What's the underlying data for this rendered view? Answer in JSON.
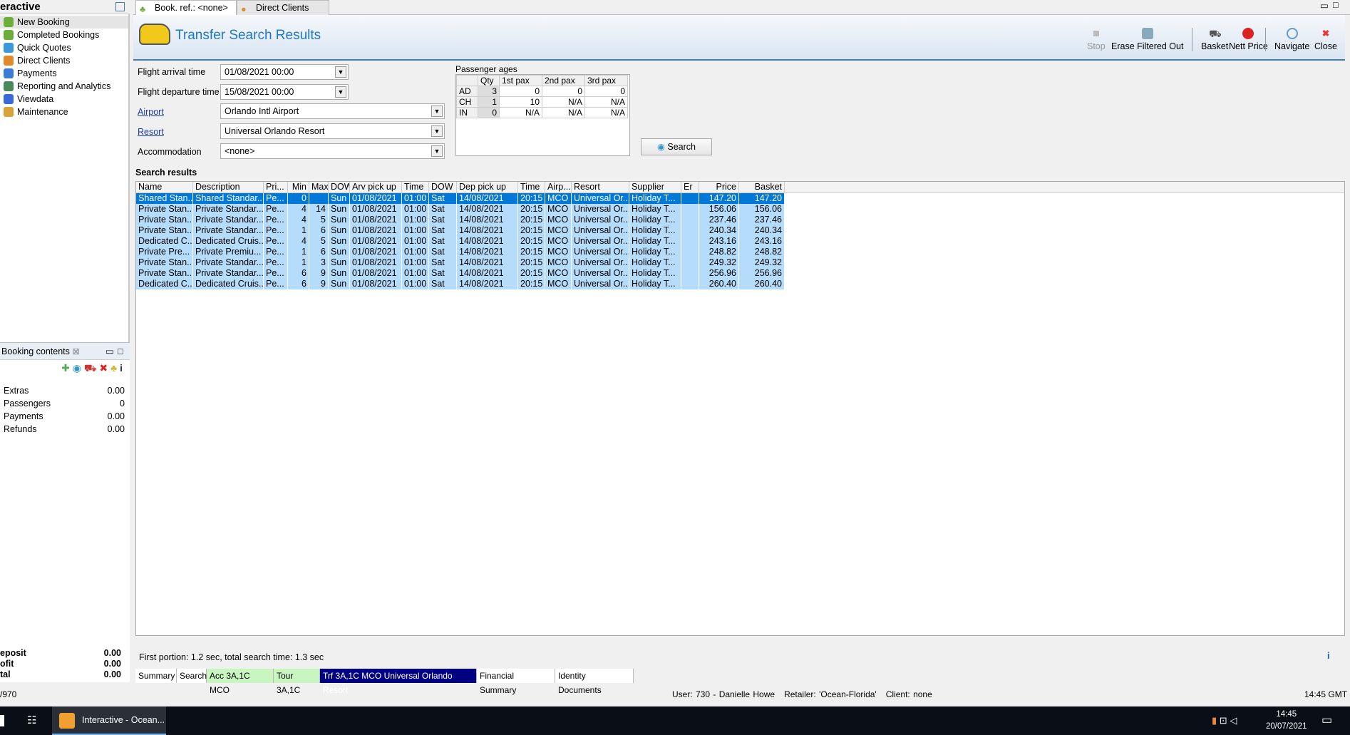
{
  "left_panel": {
    "title": "eractive",
    "nav": [
      {
        "label": "New Booking",
        "color": "#6cae3a"
      },
      {
        "label": "Completed Bookings",
        "color": "#6cae3a"
      },
      {
        "label": "Quick Quotes",
        "color": "#3a9ad9"
      },
      {
        "label": "Direct Clients",
        "color": "#e08a2a"
      },
      {
        "label": "Payments",
        "color": "#3a7ad9"
      },
      {
        "label": "Reporting and Analytics",
        "color": "#4a8a5a"
      },
      {
        "label": "Viewdata",
        "color": "#3a6ad9"
      },
      {
        "label": "Maintenance",
        "color": "#d9a23a"
      }
    ]
  },
  "booking_contents": {
    "title": "Booking contents",
    "rows": [
      {
        "label": "Extras",
        "value": "0.00"
      },
      {
        "label": "Passengers",
        "value": "0"
      },
      {
        "label": "Payments",
        "value": "0.00"
      },
      {
        "label": "Refunds",
        "value": "0.00"
      }
    ],
    "totals": [
      {
        "label": "eposit",
        "value": "0.00"
      },
      {
        "label": "ofit",
        "value": "0.00"
      },
      {
        "label": "tal",
        "value": "0.00"
      }
    ]
  },
  "tabs": [
    {
      "label": "Book. ref.: <none>"
    },
    {
      "label": "Direct Clients Search"
    }
  ],
  "header": {
    "title": "Transfer Search Results",
    "toolbar": [
      "Stop",
      "Erase Filtered Out",
      "Basket",
      "Nett Price",
      "Navigate",
      "Close"
    ]
  },
  "form": {
    "arrival_label": "Flight arrival time",
    "arrival": "01/08/2021 00:00",
    "departure_label": "Flight departure time",
    "departure": "15/08/2021 00:00",
    "airport_label": "Airport",
    "airport": "Orlando Intl Airport",
    "resort_label": "Resort",
    "resort": "Universal Orlando Resort",
    "accommodation_label": "Accommodation",
    "accommodation": "<none>",
    "search_button": "Search"
  },
  "pax": {
    "title": "Passenger ages",
    "headers": [
      "",
      "Qty",
      "1st pax",
      "2nd pax",
      "3rd pax"
    ],
    "rows": [
      [
        "AD",
        "3",
        "0",
        "0",
        "0"
      ],
      [
        "CH",
        "1",
        "10",
        "N/A",
        "N/A"
      ],
      [
        "IN",
        "0",
        "N/A",
        "N/A",
        "N/A"
      ]
    ]
  },
  "results": {
    "title": "Search results",
    "columns": [
      "Name",
      "Description",
      "Pri...",
      "Min",
      "Max",
      "DOW",
      "Arv pick up",
      "Time",
      "DOW",
      "Dep pick up",
      "Time",
      "Airp...",
      "Resort",
      "Supplier",
      "Er",
      "Price",
      "Basket"
    ],
    "rows": [
      [
        "Shared Stan...",
        "Shared Standar...",
        "Pe...",
        "0",
        "",
        "Sun",
        "01/08/2021",
        "01:00",
        "Sat",
        "14/08/2021",
        "20:15",
        "MCO",
        "Universal Or...",
        "Holiday T...",
        "",
        "147.20",
        "147.20"
      ],
      [
        "Private Stan...",
        "Private Standar...",
        "Pe...",
        "4",
        "14",
        "Sun",
        "01/08/2021",
        "01:00",
        "Sat",
        "14/08/2021",
        "20:15",
        "MCO",
        "Universal Or...",
        "Holiday T...",
        "",
        "156.06",
        "156.06"
      ],
      [
        "Private Stan...",
        "Private Standar...",
        "Pe...",
        "4",
        "5",
        "Sun",
        "01/08/2021",
        "01:00",
        "Sat",
        "14/08/2021",
        "20:15",
        "MCO",
        "Universal Or...",
        "Holiday T...",
        "",
        "237.46",
        "237.46"
      ],
      [
        "Private Stan...",
        "Private Standar...",
        "Pe...",
        "1",
        "6",
        "Sun",
        "01/08/2021",
        "01:00",
        "Sat",
        "14/08/2021",
        "20:15",
        "MCO",
        "Universal Or...",
        "Holiday T...",
        "",
        "240.34",
        "240.34"
      ],
      [
        "Dedicated C...",
        "Dedicated Cruis...",
        "Pe...",
        "4",
        "5",
        "Sun",
        "01/08/2021",
        "01:00",
        "Sat",
        "14/08/2021",
        "20:15",
        "MCO",
        "Universal Or...",
        "Holiday T...",
        "",
        "243.16",
        "243.16"
      ],
      [
        "Private Pre...",
        "Private Premiu...",
        "Pe...",
        "1",
        "6",
        "Sun",
        "01/08/2021",
        "01:00",
        "Sat",
        "14/08/2021",
        "20:15",
        "MCO",
        "Universal Or...",
        "Holiday T...",
        "",
        "248.82",
        "248.82"
      ],
      [
        "Private Stan...",
        "Private Standar...",
        "Pe...",
        "1",
        "3",
        "Sun",
        "01/08/2021",
        "01:00",
        "Sat",
        "14/08/2021",
        "20:15",
        "MCO",
        "Universal Or...",
        "Holiday T...",
        "",
        "249.32",
        "249.32"
      ],
      [
        "Private Stan...",
        "Private Standar...",
        "Pe...",
        "6",
        "9",
        "Sun",
        "01/08/2021",
        "01:00",
        "Sat",
        "14/08/2021",
        "20:15",
        "MCO",
        "Universal Or...",
        "Holiday T...",
        "",
        "256.96",
        "256.96"
      ],
      [
        "Dedicated C...",
        "Dedicated Cruis...",
        "Pe...",
        "6",
        "9",
        "Sun",
        "01/08/2021",
        "01:00",
        "Sat",
        "14/08/2021",
        "20:15",
        "MCO",
        "Universal Or...",
        "Holiday T...",
        "",
        "260.40",
        "260.40"
      ]
    ]
  },
  "status_text": "First portion: 1.2 sec, total search time: 1.3 sec",
  "bottom_tabs": [
    {
      "label": "Summary",
      "bg": "#ffffff",
      "fg": "#000"
    },
    {
      "label": "Search",
      "bg": "#ffffff",
      "fg": "#000"
    },
    {
      "label": "Acc 3A,1C MCO",
      "bg": "#c8f5c0",
      "fg": "#000"
    },
    {
      "label": "Tour 3A,1C",
      "bg": "#c8f5c0",
      "fg": "#000"
    },
    {
      "label": "Trf 3A,1C MCO Universal Orlando Resort",
      "bg": "#000080",
      "fg": "#ffffff"
    },
    {
      "label": "Financial Summary",
      "bg": "#ffffff",
      "fg": "#000"
    },
    {
      "label": "Identity Documents",
      "bg": "#ffffff",
      "fg": "#000"
    }
  ],
  "statusbar": {
    "left": "/970",
    "user": "User: 730 - Danielle Howe",
    "retailer": "Retailer: 'Ocean-Florida'",
    "client": "Client: none",
    "time": "14:45 GMT"
  },
  "taskbar": {
    "app": "Interactive - Ocean...",
    "time": "14:45",
    "date": "20/07/2021"
  }
}
